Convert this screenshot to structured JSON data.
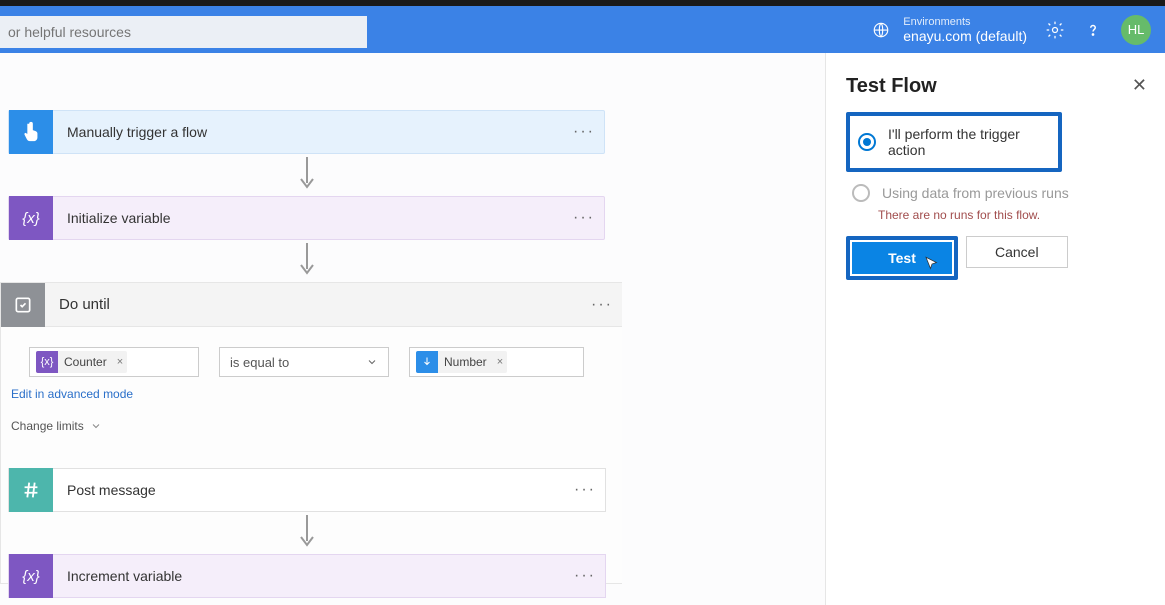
{
  "header": {
    "search_placeholder": "or helpful resources",
    "env_label": "Environments",
    "env_name": "enayu.com (default)",
    "avatar": "HL"
  },
  "flow": {
    "trigger": {
      "title": "Manually trigger a flow"
    },
    "init": {
      "title": "Initialize variable"
    },
    "dountil": {
      "title": "Do until",
      "token_left": "Counter",
      "operator": "is equal to",
      "token_right": "Number",
      "edit_link": "Edit in advanced mode",
      "change_limits": "Change limits"
    },
    "post": {
      "title": "Post message"
    },
    "incr": {
      "title": "Increment variable"
    }
  },
  "panel": {
    "title": "Test Flow",
    "opt_manual": "I'll perform the trigger action",
    "opt_previous": "Using data from previous runs",
    "no_runs": "There are no runs for this flow.",
    "test_btn": "Test",
    "cancel_btn": "Cancel"
  }
}
